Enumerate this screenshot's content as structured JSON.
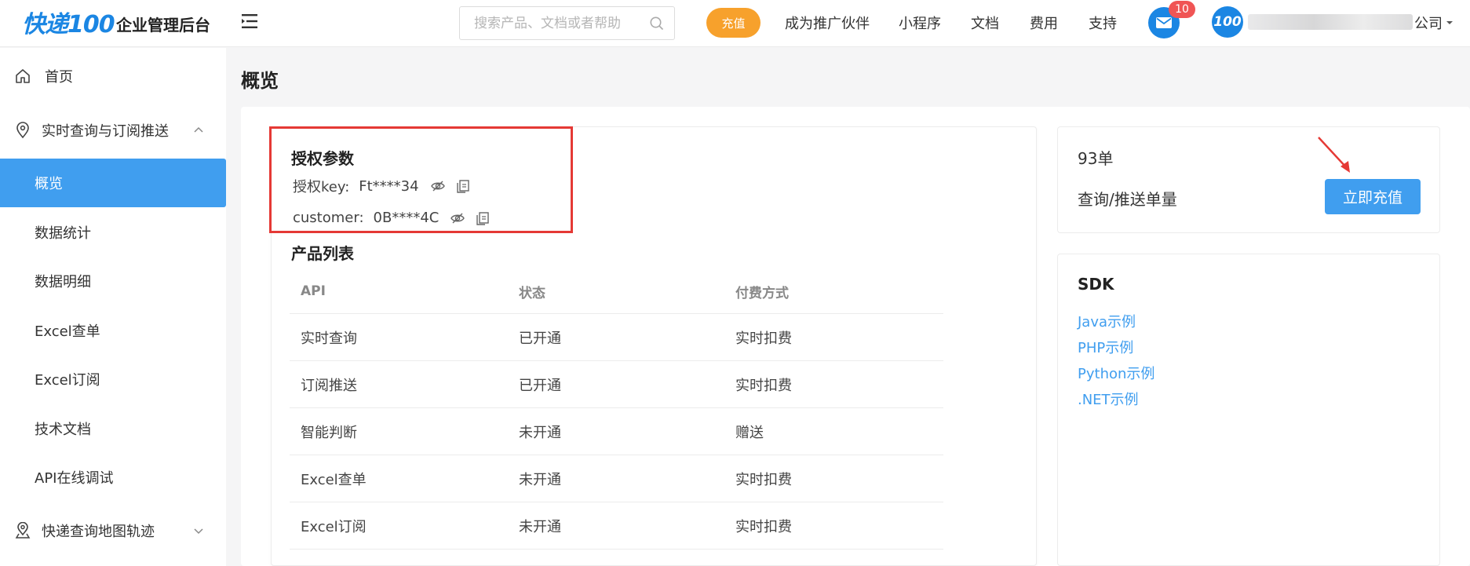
{
  "header": {
    "logo_text": "快递",
    "logo_num": "100",
    "app_title": "企业管理后台",
    "search_placeholder": "搜索产品、文档或者帮助",
    "charge_label": "充值",
    "nav": [
      "成为推广伙伴",
      "小程序",
      "文档",
      "费用",
      "支持"
    ],
    "mail_badge": "10",
    "avatar_text": "100",
    "company_suffix": "公司",
    "accent": "#1b86e3",
    "orange": "#f7a12c"
  },
  "sidebar": {
    "home": "首页",
    "group1": "实时查询与订阅推送",
    "items": [
      "概览",
      "数据统计",
      "数据明细",
      "Excel查单",
      "Excel订阅",
      "技术文档",
      "API在线调试"
    ],
    "group2": "快递查询地图轨迹",
    "active_index": 0,
    "active_color": "#409eef"
  },
  "page": {
    "title": "概览"
  },
  "auth": {
    "title": "授权参数",
    "key_label": "授权key:",
    "key_value": "Ft****34",
    "customer_label": "customer:",
    "customer_value": "0B****4C"
  },
  "products": {
    "title": "产品列表",
    "columns": [
      "API",
      "状态",
      "付费方式"
    ],
    "rows": [
      [
        "实时查询",
        "已开通",
        "实时扣费"
      ],
      [
        "订阅推送",
        "已开通",
        "实时扣费"
      ],
      [
        "智能判断",
        "未开通",
        "赠送"
      ],
      [
        "Excel查单",
        "未开通",
        "实时扣费"
      ],
      [
        "Excel订阅",
        "未开通",
        "实时扣费"
      ]
    ]
  },
  "balance": {
    "value": "93单",
    "label": "查询/推送单量",
    "button": "立即充值"
  },
  "sdk": {
    "title": "SDK",
    "links": [
      "Java示例",
      "PHP示例",
      "Python示例",
      ".NET示例"
    ]
  }
}
